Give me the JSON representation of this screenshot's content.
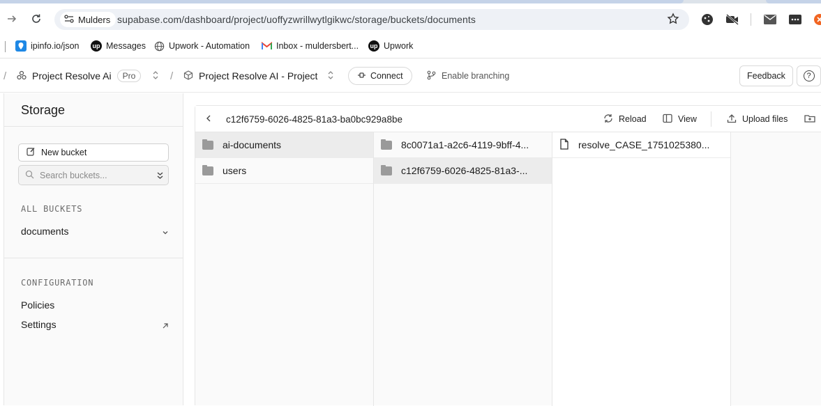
{
  "browser": {
    "profile_name": "Mulders",
    "url": "supabase.com/dashboard/project/uoffyzwrillwytlgikwc/storage/buckets/documents",
    "bookmarks": [
      {
        "label": "ipinfo.io/json",
        "icon": "ipinfo-icon"
      },
      {
        "label": "Messages",
        "icon": "upwork-icon"
      },
      {
        "label": "Upwork - Automation",
        "icon": "globe-icon"
      },
      {
        "label": "Inbox - muldersbert...",
        "icon": "gmail-icon"
      },
      {
        "label": "Upwork",
        "icon": "upwork-icon"
      }
    ]
  },
  "header": {
    "org": "Project Resolve Ai",
    "plan_badge": "Pro",
    "project": "Project Resolve AI - Project",
    "connect_label": "Connect",
    "branching_label": "Enable branching",
    "feedback_label": "Feedback",
    "help_label": "?"
  },
  "sidebar": {
    "title": "Storage",
    "new_bucket_label": "New bucket",
    "search_placeholder": "Search buckets...",
    "all_buckets_label": "ALL BUCKETS",
    "buckets": [
      "documents"
    ],
    "configuration_label": "CONFIGURATION",
    "config_items": [
      "Policies",
      "Settings"
    ]
  },
  "explorer": {
    "path": "c12f6759-6026-4825-81a3-ba0bc929a8be",
    "reload_label": "Reload",
    "view_label": "View",
    "upload_label": "Upload files",
    "columns": [
      {
        "items": [
          {
            "name": "ai-documents",
            "type": "folder",
            "selected": true
          },
          {
            "name": "users",
            "type": "folder",
            "selected": false
          }
        ]
      },
      {
        "items": [
          {
            "name": "8c0071a1-a2c6-4119-9bff-4...",
            "type": "folder",
            "selected": false
          },
          {
            "name": "c12f6759-6026-4825-81a3-...",
            "type": "folder",
            "selected": true
          }
        ]
      },
      {
        "items": [
          {
            "name": "resolve_CASE_1751025380...",
            "type": "file",
            "selected": false
          }
        ]
      }
    ]
  },
  "colors": {
    "accent_orange": "#f16522",
    "sidebar_bg": "#fafafa",
    "selected_row": "#ececec"
  }
}
